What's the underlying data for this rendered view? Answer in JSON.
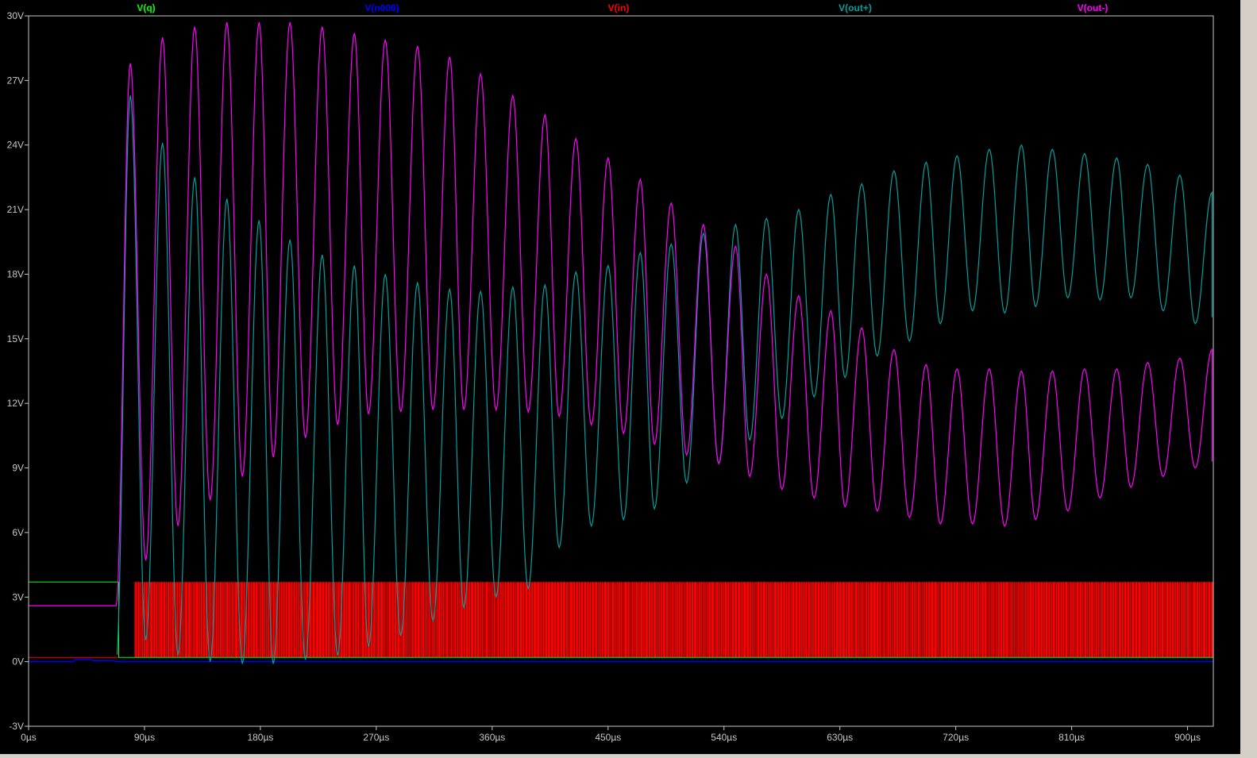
{
  "chart_data": {
    "type": "line",
    "title": "",
    "xlabel": "",
    "ylabel": "",
    "xlim": [
      0,
      920
    ],
    "ylim": [
      -3,
      30
    ],
    "x_unit": "µs",
    "y_unit": "V",
    "x_ticks": [
      0,
      90,
      180,
      270,
      360,
      450,
      540,
      630,
      720,
      810,
      900
    ],
    "x_tick_labels": [
      "0µs",
      "90µs",
      "180µs",
      "270µs",
      "360µs",
      "450µs",
      "540µs",
      "630µs",
      "720µs",
      "810µs",
      "900µs"
    ],
    "y_ticks": [
      30,
      27,
      24,
      21,
      18,
      15,
      12,
      9,
      6,
      3,
      0,
      -3
    ],
    "y_tick_labels": [
      "30V",
      "27V",
      "24V",
      "21V",
      "18V",
      "15V",
      "12V",
      "9V",
      "6V",
      "3V",
      "0V",
      "-3V"
    ],
    "grid": false,
    "legend_position": "top",
    "background": "#000000",
    "series": [
      {
        "name": "V(q)",
        "color": "#00ff00",
        "kind": "digital",
        "description": "logic high ≈3.7 V until switching starts at ≈70 µs",
        "values": [
          [
            0,
            3.7
          ],
          [
            70,
            3.7
          ],
          [
            70,
            0.2
          ],
          [
            920,
            0.2
          ]
        ]
      },
      {
        "name": "V(n006)",
        "color": "#0000ff",
        "kind": "line",
        "values": [
          [
            0,
            0
          ],
          [
            35,
            0
          ],
          [
            36,
            0.1
          ],
          [
            48,
            0.1
          ],
          [
            50,
            0.05
          ],
          [
            66,
            0.05
          ],
          [
            68,
            0
          ],
          [
            920,
            0
          ]
        ]
      },
      {
        "name": "V(in)",
        "color": "#ff0000",
        "kind": "pwm",
        "low": 0.2,
        "high": 3.7,
        "start_us": 82,
        "values": [
          [
            0,
            0.2
          ],
          [
            70,
            0.2
          ],
          [
            82,
            3.7
          ],
          [
            920,
            3.7
          ]
        ]
      },
      {
        "name": "V(out+)",
        "color": "#00a0a0",
        "kind": "envelope_oscillation",
        "start_us": 68,
        "period_us": 24.7,
        "peaks": [
          [
            79,
            26.3
          ],
          [
            104,
            24.1
          ],
          [
            129,
            22.5
          ],
          [
            154,
            21.5
          ],
          [
            179,
            20.5
          ],
          [
            203,
            19.6
          ],
          [
            228,
            18.9
          ],
          [
            253,
            18.4
          ],
          [
            277,
            18.0
          ],
          [
            302,
            17.6
          ],
          [
            327,
            17.3
          ],
          [
            351,
            17.2
          ],
          [
            376,
            17.4
          ],
          [
            401,
            17.5
          ],
          [
            425,
            18.1
          ],
          [
            450,
            18.4
          ],
          [
            475,
            19.0
          ],
          [
            499,
            19.4
          ],
          [
            524,
            19.9
          ],
          [
            549,
            20.3
          ],
          [
            573,
            20.6
          ],
          [
            598,
            21.0
          ],
          [
            623,
            21.7
          ],
          [
            647,
            22.2
          ],
          [
            672,
            22.8
          ],
          [
            697,
            23.2
          ],
          [
            721,
            23.5
          ],
          [
            746,
            23.8
          ],
          [
            771,
            24.0
          ],
          [
            795,
            23.8
          ],
          [
            820,
            23.6
          ],
          [
            845,
            23.4
          ],
          [
            869,
            23.1
          ],
          [
            894,
            22.6
          ],
          [
            919,
            21.8
          ]
        ],
        "troughs": [
          [
            91,
            1.0
          ],
          [
            116,
            0.3
          ],
          [
            141,
            0.0
          ],
          [
            166,
            -0.1
          ],
          [
            190,
            -0.1
          ],
          [
            215,
            0.1
          ],
          [
            240,
            0.3
          ],
          [
            264,
            0.7
          ],
          [
            289,
            1.2
          ],
          [
            314,
            1.9
          ],
          [
            338,
            2.5
          ],
          [
            363,
            3.0
          ],
          [
            388,
            3.4
          ],
          [
            412,
            5.3
          ],
          [
            437,
            6.3
          ],
          [
            462,
            6.6
          ],
          [
            486,
            7.1
          ],
          [
            511,
            8.3
          ],
          [
            536,
            9.2
          ],
          [
            560,
            10.3
          ],
          [
            585,
            11.3
          ],
          [
            610,
            12.3
          ],
          [
            634,
            13.2
          ],
          [
            659,
            14.2
          ],
          [
            684,
            14.9
          ],
          [
            708,
            15.7
          ],
          [
            733,
            16.3
          ],
          [
            758,
            16.2
          ],
          [
            782,
            16.5
          ],
          [
            807,
            16.9
          ],
          [
            832,
            16.8
          ],
          [
            856,
            16.9
          ],
          [
            881,
            16.3
          ],
          [
            906,
            15.7
          ],
          [
            919,
            16.0
          ]
        ]
      },
      {
        "name": "V(out-)",
        "color": "#ff00ff",
        "kind": "envelope_oscillation",
        "start_us": 68,
        "period_us": 24.7,
        "peaks": [
          [
            79,
            27.8
          ],
          [
            104,
            29.0
          ],
          [
            129,
            29.5
          ],
          [
            154,
            29.7
          ],
          [
            179,
            29.7
          ],
          [
            203,
            29.7
          ],
          [
            228,
            29.5
          ],
          [
            253,
            29.2
          ],
          [
            277,
            28.9
          ],
          [
            302,
            28.6
          ],
          [
            327,
            28.1
          ],
          [
            351,
            27.3
          ],
          [
            376,
            26.3
          ],
          [
            401,
            25.4
          ],
          [
            425,
            24.3
          ],
          [
            450,
            23.4
          ],
          [
            475,
            22.4
          ],
          [
            499,
            21.3
          ],
          [
            524,
            20.3
          ],
          [
            549,
            19.3
          ],
          [
            573,
            18.0
          ],
          [
            598,
            17.0
          ],
          [
            623,
            16.3
          ],
          [
            647,
            15.5
          ],
          [
            672,
            14.5
          ],
          [
            697,
            13.8
          ],
          [
            721,
            13.6
          ],
          [
            746,
            13.6
          ],
          [
            771,
            13.5
          ],
          [
            795,
            13.5
          ],
          [
            820,
            13.6
          ],
          [
            845,
            13.6
          ],
          [
            869,
            13.9
          ],
          [
            894,
            14.1
          ],
          [
            919,
            14.5
          ]
        ],
        "troughs": [
          [
            91,
            4.7
          ],
          [
            116,
            6.3
          ],
          [
            141,
            7.5
          ],
          [
            166,
            8.6
          ],
          [
            190,
            9.5
          ],
          [
            215,
            10.4
          ],
          [
            240,
            11.0
          ],
          [
            264,
            11.5
          ],
          [
            289,
            11.6
          ],
          [
            314,
            11.7
          ],
          [
            338,
            11.7
          ],
          [
            363,
            11.7
          ],
          [
            388,
            11.6
          ],
          [
            412,
            11.4
          ],
          [
            437,
            11.0
          ],
          [
            462,
            10.6
          ],
          [
            486,
            10.1
          ],
          [
            511,
            9.6
          ],
          [
            536,
            9.2
          ],
          [
            560,
            8.6
          ],
          [
            585,
            8.0
          ],
          [
            610,
            7.6
          ],
          [
            634,
            7.2
          ],
          [
            659,
            7.0
          ],
          [
            684,
            6.7
          ],
          [
            708,
            6.4
          ],
          [
            733,
            6.4
          ],
          [
            758,
            6.3
          ],
          [
            782,
            6.6
          ],
          [
            807,
            7.0
          ],
          [
            832,
            7.6
          ],
          [
            856,
            8.1
          ],
          [
            881,
            8.6
          ],
          [
            906,
            9.0
          ],
          [
            919,
            9.3
          ]
        ],
        "pre_start_level": 2.6
      }
    ]
  }
}
